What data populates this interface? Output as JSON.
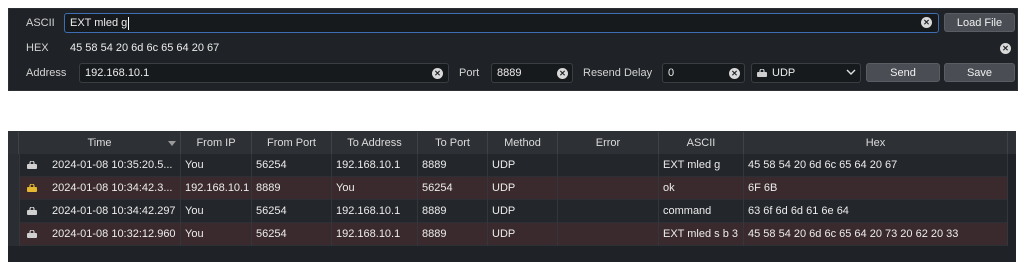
{
  "controls": {
    "ascii_label": "ASCII",
    "ascii_value": "EXT mled g",
    "load_file_label": "Load File",
    "hex_label": "HEX",
    "hex_value": "45 58 54 20 6d 6c 65 64 20 67",
    "address_label": "Address",
    "address_value": "192.168.10.1",
    "port_label": "Port",
    "port_value": "8889",
    "resend_label": "Resend Delay",
    "resend_value": "0",
    "protocol_value": "UDP",
    "send_label": "Send",
    "save_label": "Save"
  },
  "table": {
    "headers": [
      "Time",
      "From IP",
      "From Port",
      "To Address",
      "To Port",
      "Method",
      "Error",
      "ASCII",
      "Hex"
    ],
    "rows": [
      {
        "time": "2024-01-08 10:35:20.5...",
        "from_ip": "You",
        "from_port": "56254",
        "to_address": "192.168.10.1",
        "to_port": "8889",
        "method": "UDP",
        "error": "",
        "ascii": "EXT mled g",
        "hex": "45 58 54 20 6d 6c 65 64 20 67",
        "icon_color": "#d0d0d0"
      },
      {
        "time": "2024-01-08 10:34:42.3...",
        "from_ip": "192.168.10.1",
        "from_port": "8889",
        "to_address": "You",
        "to_port": "56254",
        "method": "UDP",
        "error": "",
        "ascii": "ok",
        "hex": "6F 6B",
        "icon_color": "#e6b830"
      },
      {
        "time": "2024-01-08 10:34:42.297",
        "from_ip": "You",
        "from_port": "56254",
        "to_address": "192.168.10.1",
        "to_port": "8889",
        "method": "UDP",
        "error": "",
        "ascii": "command",
        "hex": "63 6f 6d 6d 61 6e 64",
        "icon_color": "#d0d0d0"
      },
      {
        "time": "2024-01-08 10:32:12.960",
        "from_ip": "You",
        "from_port": "56254",
        "to_address": "192.168.10.1",
        "to_port": "8889",
        "method": "UDP",
        "error": "",
        "ascii": "EXT mled s b 3",
        "hex": "45 58 54 20 6d 6c 65 64 20 73 20 62 20 33",
        "icon_color": "#d0d0d0"
      }
    ]
  }
}
